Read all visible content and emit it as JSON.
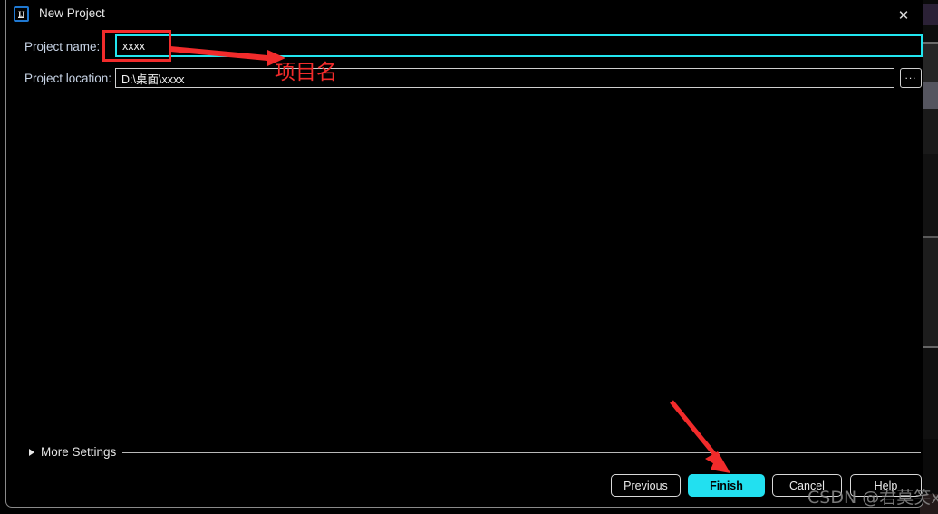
{
  "window": {
    "title": "New Project",
    "app_icon": "IJ",
    "close_icon": "✕"
  },
  "form": {
    "name_label": "Project name:",
    "name_value": "xxxx",
    "name_placeholder": "",
    "location_label": "Project location:",
    "location_value": "D:\\桌面\\xxxx",
    "location_placeholder": "",
    "browse_label": "..."
  },
  "more_settings": {
    "label": "More Settings",
    "expanded": false
  },
  "buttons": {
    "previous": "Previous",
    "finish": "Finish",
    "cancel": "Cancel",
    "help": "Help"
  },
  "annotations": {
    "name_callout_text": "项目名",
    "highlight_color": "#f22b2b",
    "focus_border_color": "#22e6f0",
    "accent_color": "#22e0f0"
  },
  "watermark": {
    "text": "CSDN @君莫笑xy"
  }
}
